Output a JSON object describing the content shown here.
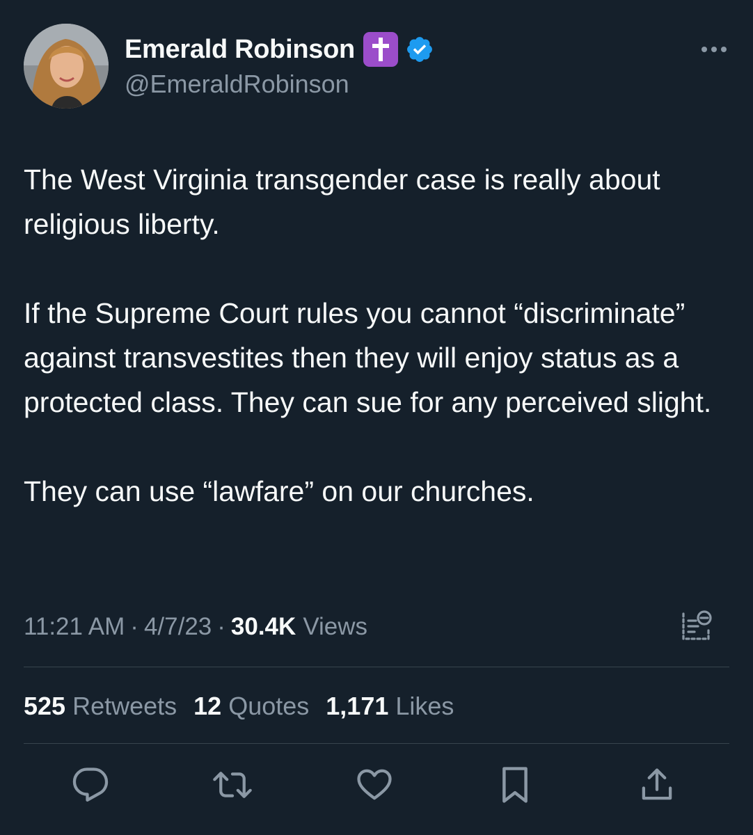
{
  "author": {
    "display_name": "Emerald Robinson",
    "handle": "@EmeraldRobinson",
    "emoji_icon": "latin-cross-emoji",
    "verified_icon": "verified-badge-icon",
    "verified_color": "#1d9bf0"
  },
  "tweet": {
    "paragraphs": [
      "The West Virginia transgender case is really about religious liberty.",
      "If the Supreme Court rules you cannot “discriminate” against transvestites then they will enjoy status as a protected class. They can sue for any perceived slight.",
      "They can use “lawfare” on our churches."
    ]
  },
  "meta": {
    "time": "11:21 AM",
    "separator": "·",
    "date": "4/7/23",
    "views_count": "30.4K",
    "views_label": "Views"
  },
  "stats": {
    "retweets_count": "525",
    "retweets_label": "Retweets",
    "quotes_count": "12",
    "quotes_label": "Quotes",
    "likes_count": "1,171",
    "likes_label": "Likes"
  },
  "actions": [
    {
      "icon": "reply-icon"
    },
    {
      "icon": "retweet-icon"
    },
    {
      "icon": "like-heart-icon"
    },
    {
      "icon": "bookmark-icon"
    },
    {
      "icon": "share-icon"
    }
  ],
  "colors": {
    "background": "#15202b",
    "primary_text": "#f7f9f9",
    "secondary_text": "#8b98a5",
    "divider": "#38444d",
    "emoji_background": "#9b4dca"
  }
}
